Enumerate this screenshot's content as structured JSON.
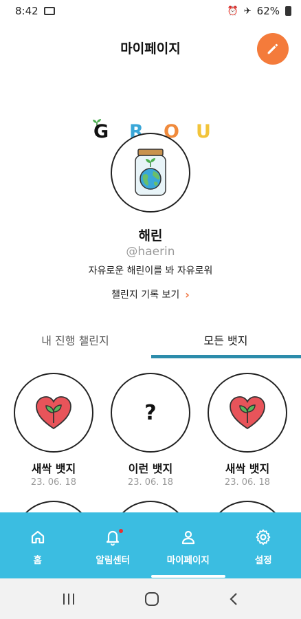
{
  "status_bar": {
    "time": "8:42",
    "battery": "62%"
  },
  "header": {
    "title": "마이페이지"
  },
  "logo": {
    "letters": [
      "G",
      "R",
      "O",
      "U"
    ],
    "colors": [
      "#111111",
      "#3aa7d8",
      "#f08a3c",
      "#f2c43a"
    ]
  },
  "profile": {
    "name": "해린",
    "handle": "@haerin",
    "bio": "자유로운 해린이를 봐 자유로워",
    "challenge_link": "챌린지 기록 보기"
  },
  "tabs": [
    {
      "label": "내 진행 챌린지",
      "active": false
    },
    {
      "label": "모든 뱃지",
      "active": true
    }
  ],
  "badges": [
    {
      "name": "새싹 뱃지",
      "date": "23. 06. 18",
      "icon": "sprout-heart-icon"
    },
    {
      "name": "이런 뱃지",
      "date": "23. 06. 18",
      "icon": "question-icon",
      "symbol": "?"
    },
    {
      "name": "새싹 뱃지",
      "date": "23. 06. 18",
      "icon": "sprout-heart-icon"
    }
  ],
  "bottom_nav": [
    {
      "label": "홈",
      "icon": "home-icon"
    },
    {
      "label": "알림센터",
      "icon": "bell-icon"
    },
    {
      "label": "마이페이지",
      "icon": "person-icon"
    },
    {
      "label": "설정",
      "icon": "gear-icon"
    }
  ],
  "colors": {
    "accent": "#3bbde1",
    "edit": "#f47b3b",
    "heart": "#e8545a",
    "leaf": "#5cb85c"
  }
}
